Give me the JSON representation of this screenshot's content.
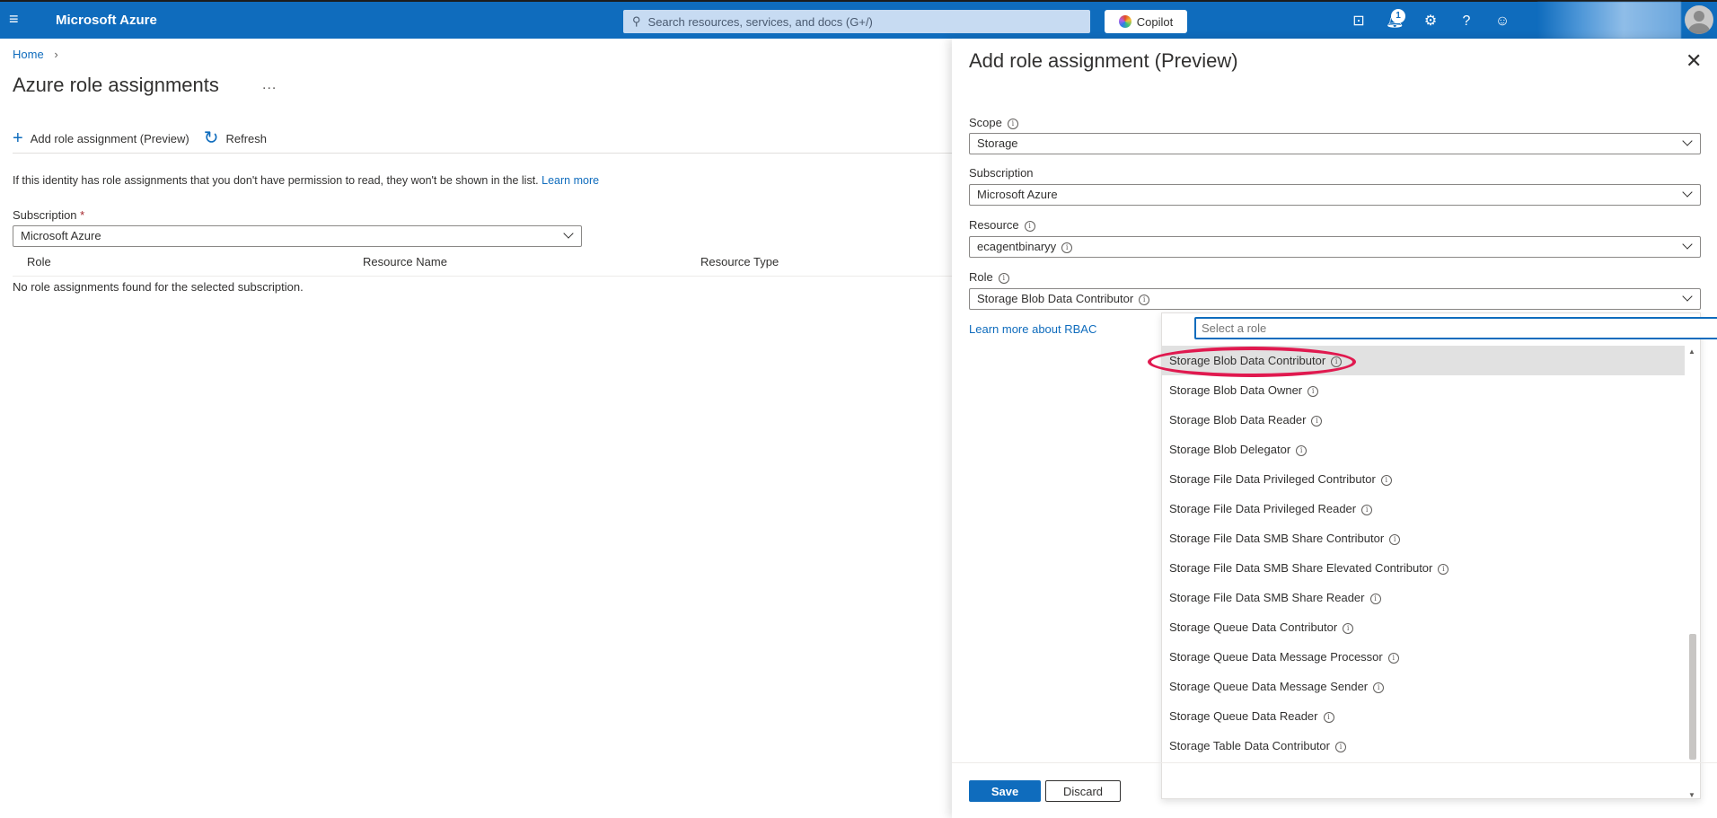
{
  "topbar": {
    "brand": "Microsoft Azure",
    "search_placeholder": "Search resources, services, and docs (G+/)",
    "copilot_label": "Copilot",
    "notification_count": "1",
    "icons": [
      "cloud-shell-icon",
      "notifications-icon",
      "settings-icon",
      "help-icon",
      "feedback-icon"
    ]
  },
  "breadcrumb": {
    "home": "Home"
  },
  "page": {
    "title": "Azure role assignments",
    "more": "...",
    "commands": {
      "add": "Add role assignment (Preview)",
      "refresh": "Refresh"
    },
    "info_text": "If this identity has role assignments that you don't have permission to read, they won't be shown in the list.",
    "info_link": "Learn more",
    "subscription_label": "Subscription",
    "subscription_required": "*",
    "subscription_value": "Microsoft Azure",
    "table": {
      "columns": [
        "Role",
        "Resource Name",
        "Resource Type"
      ],
      "empty": "No role assignments found for the selected subscription."
    }
  },
  "panel": {
    "title": "Add role assignment (Preview)",
    "scope_label": "Scope",
    "scope_value": "Storage",
    "subscription_label": "Subscription",
    "subscription_value": "Microsoft Azure",
    "resource_label": "Resource",
    "resource_value": "ecagentbinaryy",
    "role_label": "Role",
    "role_value": "Storage Blob Data Contributor",
    "rbac_link": "Learn more about RBAC",
    "role_search_placeholder": "Select a role",
    "roles": [
      "Storage Blob Data Contributor",
      "Storage Blob Data Owner",
      "Storage Blob Data Reader",
      "Storage Blob Delegator",
      "Storage File Data Privileged Contributor",
      "Storage File Data Privileged Reader",
      "Storage File Data SMB Share Contributor",
      "Storage File Data SMB Share Elevated Contributor",
      "Storage File Data SMB Share Reader",
      "Storage Queue Data Contributor",
      "Storage Queue Data Message Processor",
      "Storage Queue Data Message Sender",
      "Storage Queue Data Reader",
      "Storage Table Data Contributor"
    ],
    "selected_role_index": 0,
    "save_label": "Save",
    "discard_label": "Discard"
  },
  "colors": {
    "accent": "#0f6cbd",
    "highlight": "#e0194f"
  }
}
